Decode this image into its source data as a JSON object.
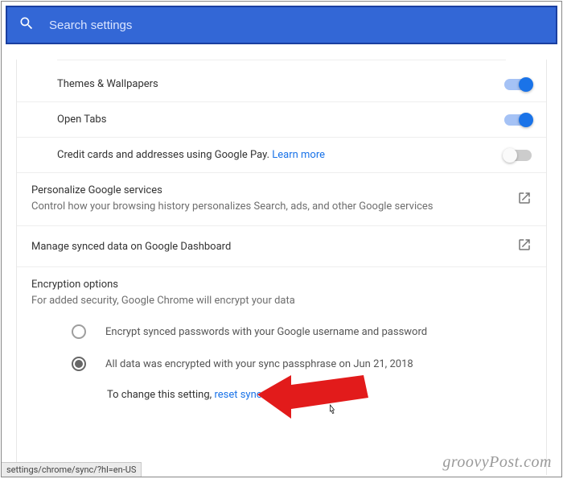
{
  "search": {
    "placeholder": "Search settings"
  },
  "sync_items": {
    "themes": {
      "label": "Themes & Wallpapers",
      "on": true
    },
    "tabs": {
      "label": "Open Tabs",
      "on": true
    },
    "credit": {
      "label": "Credit cards and addresses using Google Pay. ",
      "learn": "Learn more",
      "on": false
    }
  },
  "personalize": {
    "title": "Personalize Google services",
    "sub": "Control how your browsing history personalizes Search, ads, and other Google services"
  },
  "dashboard": {
    "title": "Manage synced data on Google Dashboard"
  },
  "encryption": {
    "title": "Encryption options",
    "sub": "For added security, Google Chrome will encrypt your data",
    "opt1": "Encrypt synced passwords with your Google username and password",
    "opt2": "All data was encrypted with your sync passphrase on Jun 21, 2018",
    "reset_pre": "To change this setting, ",
    "reset_link": "reset sync",
    "reset_post": "."
  },
  "status_url": "settings/chrome/sync/?hl=en-US",
  "watermark": "groovyPost.com"
}
